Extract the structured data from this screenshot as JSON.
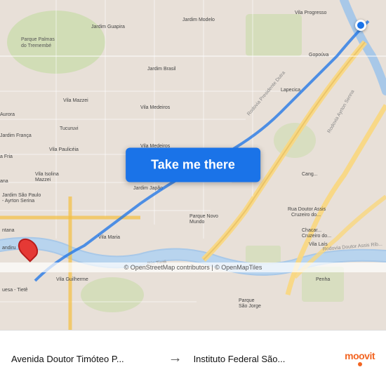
{
  "map": {
    "background_color": "#e8e0d8",
    "attribution": "© OpenStreetMap contributors | © OpenMapTiles"
  },
  "button": {
    "label": "Take me there"
  },
  "bottom_bar": {
    "from_label": "",
    "from_name": "Avenida Doutor Timóteo P...",
    "arrow": "→",
    "to_label": "",
    "to_name": "Instituto Federal São...",
    "brand": "moovit"
  },
  "pins": {
    "origin_color": "#e53935",
    "dest_color": "#1a73e8"
  }
}
